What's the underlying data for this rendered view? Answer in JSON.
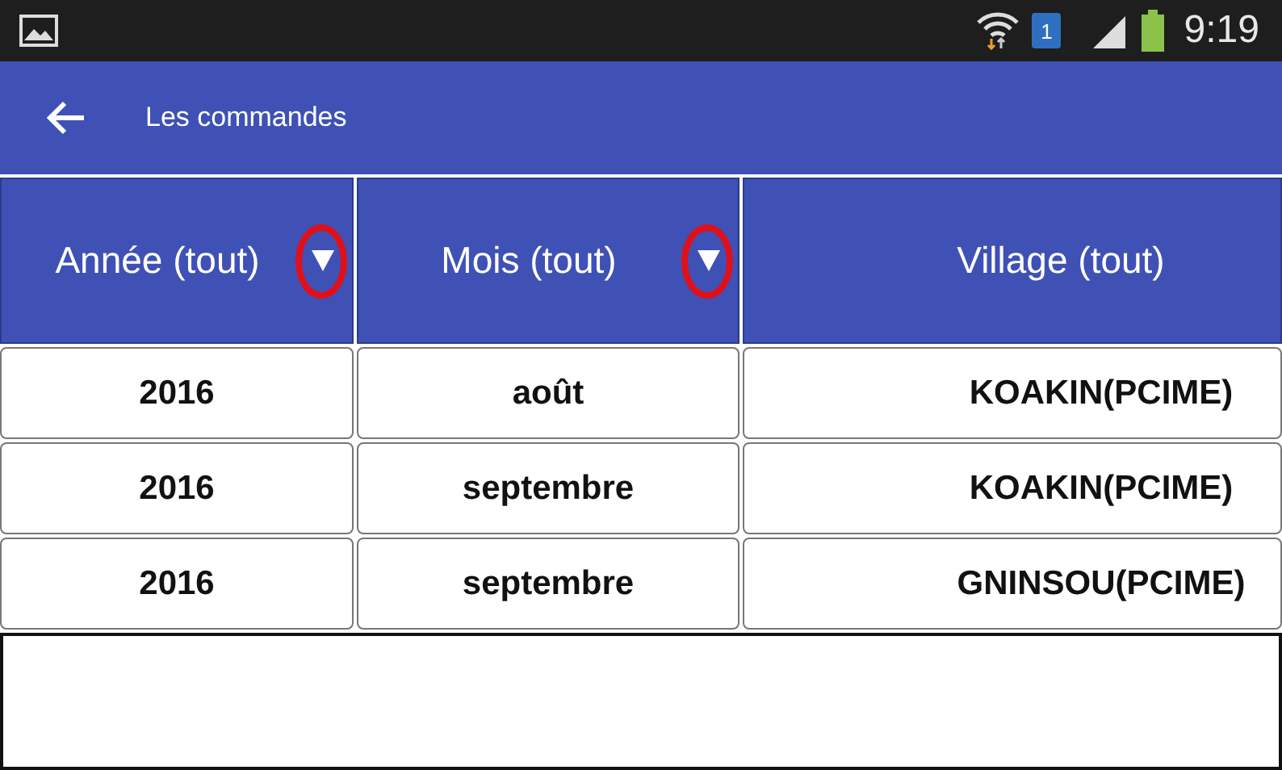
{
  "status_bar": {
    "time": "9:19",
    "sim_badge": "1"
  },
  "app_bar": {
    "title": "Les commandes"
  },
  "columns": [
    {
      "label": "Année (tout)",
      "has_dropdown": true,
      "highlighted": true
    },
    {
      "label": "Mois (tout)",
      "has_dropdown": true,
      "highlighted": true
    },
    {
      "label": "Village (tout)",
      "has_dropdown": false,
      "highlighted": false
    }
  ],
  "rows": [
    [
      "2016",
      "août",
      "KOAKIN(PCIME)"
    ],
    [
      "2016",
      "septembre",
      "KOAKIN(PCIME)"
    ],
    [
      "2016",
      "septembre",
      "GNINSOU(PCIME)"
    ]
  ]
}
